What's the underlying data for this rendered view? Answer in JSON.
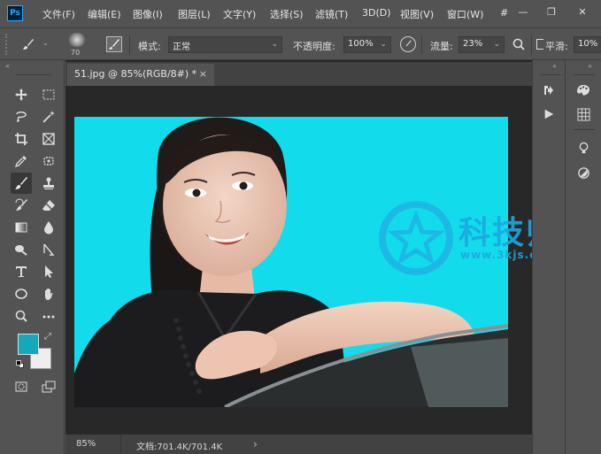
{
  "app": {
    "logo_text": "Ps",
    "menus": [
      "文件(F)",
      "编辑(E)",
      "图像(I)",
      "图层(L)",
      "文字(Y)",
      "选择(S)",
      "滤镜(T)",
      "3D(D)",
      "视图(V)",
      "窗口(W)"
    ],
    "overflow_glyph": "#"
  },
  "window_controls": {
    "minimize": "—",
    "restore": "❐",
    "close": "✕"
  },
  "options": {
    "brush_size": "70",
    "mode_label": "模式:",
    "mode_value": "正常",
    "opacity_label": "不透明度:",
    "opacity_value": "100%",
    "flow_label": "流量:",
    "flow_value": "23%",
    "smoothing_label": "平滑:",
    "smoothing_value": "10%"
  },
  "document": {
    "tab_title": "51.jpg @ 85%(RGB/8#) *",
    "close_glyph": "×"
  },
  "status": {
    "zoom": "85%",
    "doc_info": "文档:701.4K/701.4K",
    "arrow": "›"
  },
  "colors": {
    "foreground": "#14a9b9",
    "background": "#ffffff",
    "canvas_bg": "#14e0ee"
  },
  "tools": [
    "move-tool",
    "marquee-tool",
    "lasso-tool",
    "quick-select-tool",
    "crop-tool",
    "frame-tool",
    "eyedropper-tool",
    "spot-heal-tool",
    "brush-tool",
    "clone-stamp-tool",
    "history-brush-tool",
    "eraser-tool",
    "gradient-tool",
    "blur-tool",
    "dodge-tool",
    "pen-tool",
    "type-tool",
    "path-select-tool",
    "ellipse-tool",
    "hand-tool",
    "zoom-tool",
    "more-tools"
  ],
  "active_tool": "brush-tool"
}
